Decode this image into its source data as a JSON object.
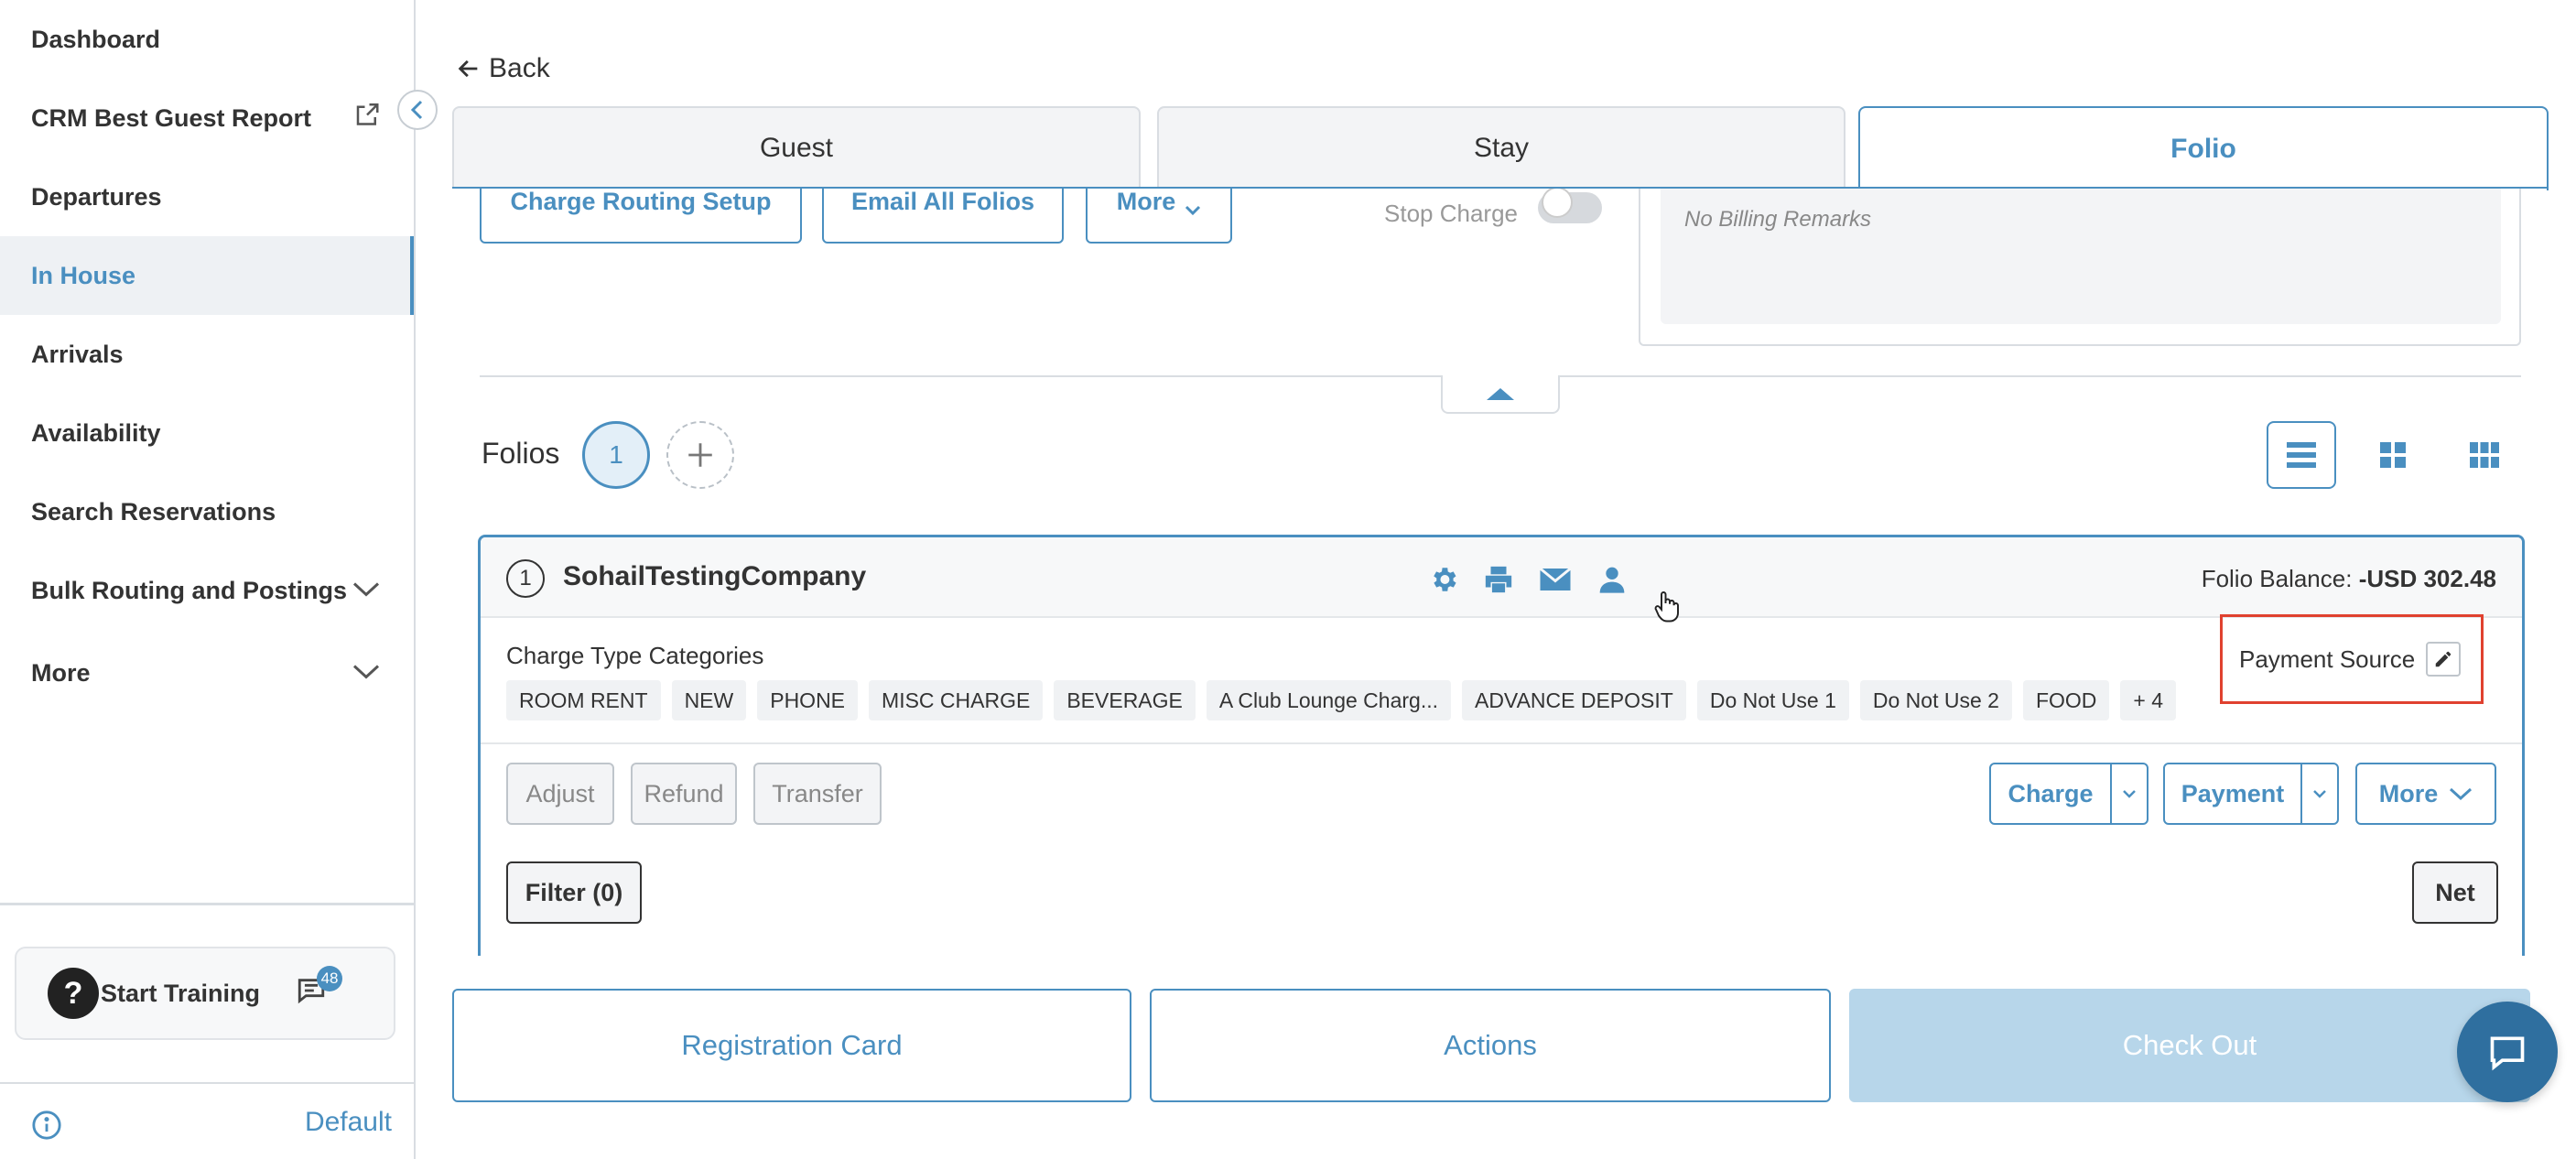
{
  "sidebar": {
    "items": [
      {
        "label": "Dashboard"
      },
      {
        "label": "CRM Best Guest Report"
      },
      {
        "label": "Departures"
      },
      {
        "label": "In House"
      },
      {
        "label": "Arrivals"
      },
      {
        "label": "Availability"
      },
      {
        "label": "Search Reservations"
      },
      {
        "label": "Bulk Routing and Postings"
      },
      {
        "label": "More"
      }
    ],
    "active_item": "In House",
    "training": {
      "label": "Start Training",
      "badge_count": "48"
    },
    "footer_default": "Default"
  },
  "header": {
    "back_label": "Back",
    "tabs": [
      {
        "label": "Guest"
      },
      {
        "label": "Stay"
      },
      {
        "label": "Folio"
      }
    ],
    "active_tab": "Folio"
  },
  "top_actions": {
    "charge_routing": "Charge Routing Setup",
    "email_all": "Email All Folios",
    "more": "More",
    "stop_charge": "Stop Charge"
  },
  "remarks": {
    "text": "No Billing Remarks"
  },
  "folios": {
    "label": "Folios",
    "selected": "1"
  },
  "folio_card": {
    "index": "1",
    "name": "SohailTestingCompany",
    "balance_label": "Folio Balance:",
    "balance_value": "-USD 302.48",
    "categories_label": "Charge Type Categories",
    "categories": [
      "ROOM RENT",
      "NEW",
      "PHONE",
      "MISC CHARGE",
      "BEVERAGE",
      "A Club Lounge Charg...",
      "ADVANCE DEPOSIT",
      "Do Not Use 1",
      "Do Not Use 2",
      "FOOD",
      "+ 4"
    ],
    "payment_source_label": "Payment Source",
    "buttons": {
      "adjust": "Adjust",
      "refund": "Refund",
      "transfer": "Transfer",
      "charge": "Charge",
      "payment": "Payment",
      "more": "More",
      "filter": "Filter (0)",
      "net": "Net"
    }
  },
  "bottom_actions": {
    "registration_card": "Registration Card",
    "actions": "Actions",
    "check_out": "Check Out"
  },
  "colors": {
    "accent": "#4a8fc0",
    "highlight_border": "#e0412f",
    "disabled": "#b7d6ea"
  }
}
